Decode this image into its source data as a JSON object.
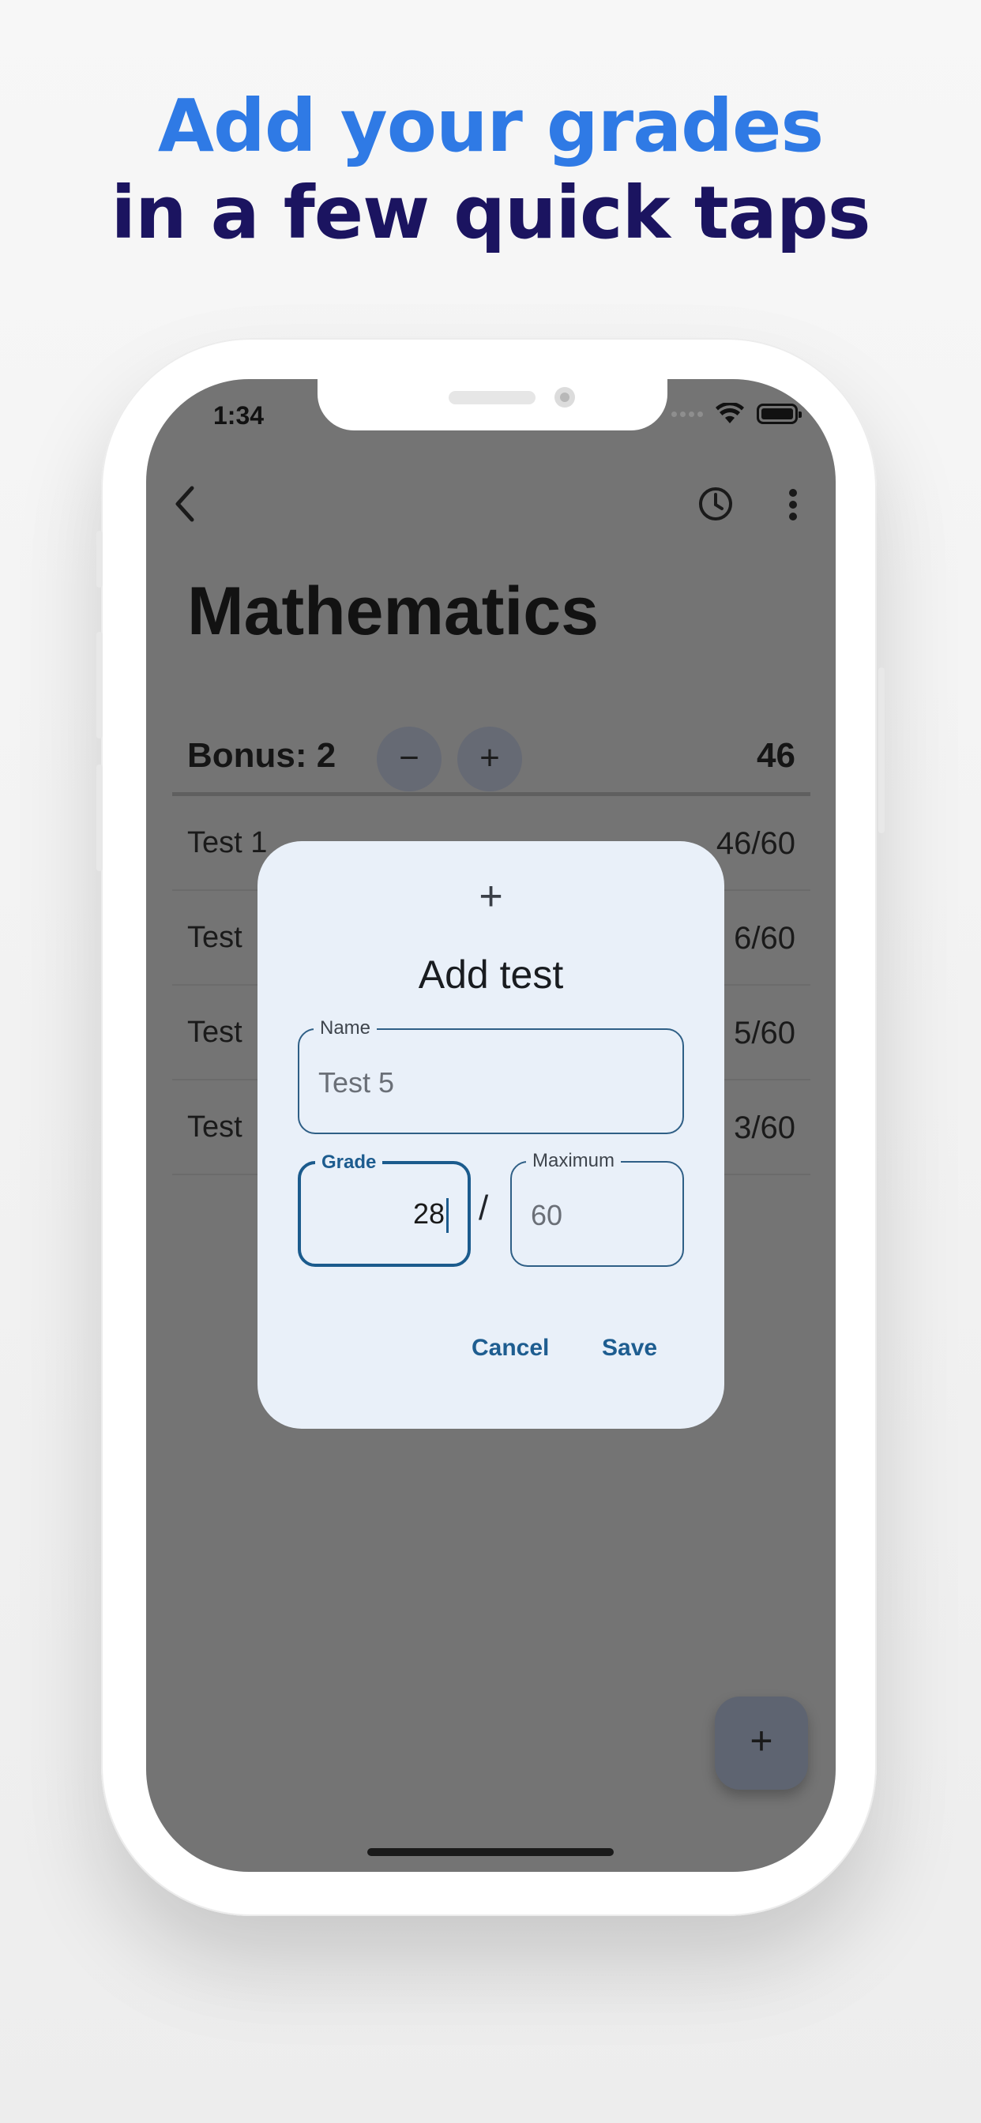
{
  "headline": {
    "line1": "Add your grades",
    "line2": "in a few quick taps"
  },
  "status_bar": {
    "time": "1:34"
  },
  "app": {
    "title": "Mathematics",
    "bonus_label": "Bonus: 2",
    "bonus_minus": "−",
    "bonus_plus": "+",
    "total": "46",
    "tests": [
      {
        "name": "Test 1",
        "score": "46/60"
      },
      {
        "name": "Test",
        "score": "6/60"
      },
      {
        "name": "Test",
        "score": "5/60"
      },
      {
        "name": "Test",
        "score": "3/60"
      }
    ],
    "fab_label": "+"
  },
  "dialog": {
    "icon": "+",
    "title": "Add test",
    "name_field": {
      "label": "Name",
      "value": "Test 5"
    },
    "grade_field": {
      "label": "Grade",
      "value": "28"
    },
    "separator": "/",
    "maximum_field": {
      "label": "Maximum",
      "value": "60"
    },
    "cancel_label": "Cancel",
    "save_label": "Save"
  },
  "colors": {
    "headline_accent": "#2f7ae5",
    "headline_dark": "#1b1460",
    "dialog_bg": "#e9f0f9",
    "primary": "#1e5d90",
    "scrim": "#747474"
  },
  "icons": [
    "back-arrow-icon",
    "history-clock-icon",
    "more-vert-icon",
    "wifi-icon",
    "battery-icon",
    "cellular-icon"
  ]
}
